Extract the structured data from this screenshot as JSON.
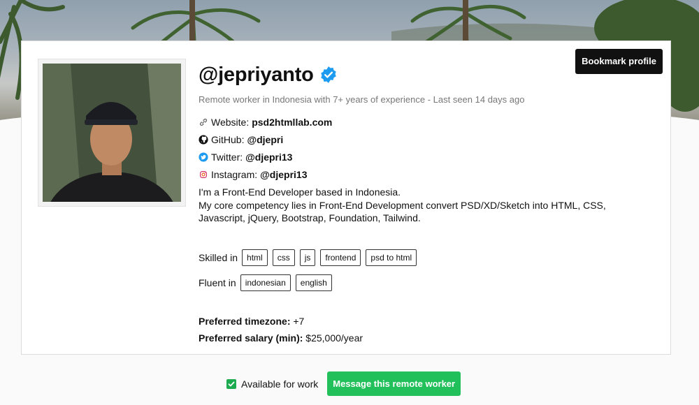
{
  "profile": {
    "username": "@jepriyanto",
    "tagline": "Remote worker in Indonesia with 7+ years of experience - Last seen 14 days ago",
    "bookmark_label": "Bookmark profile",
    "links": [
      {
        "label": "Website:",
        "value": "psd2htmllab.com",
        "icon": "link-icon"
      },
      {
        "label": "GitHub:",
        "value": "@djepri",
        "icon": "github-icon"
      },
      {
        "label": "Twitter:",
        "value": "@djepri13",
        "icon": "twitter-icon"
      },
      {
        "label": "Instagram:",
        "value": "@djepri13",
        "icon": "instagram-icon"
      }
    ],
    "bio": [
      "I'm a Front-End Developer based in Indonesia.",
      "My core competency lies in Front-End Development convert PSD/XD/Sketch into HTML, CSS, Javascript, jQuery, Bootstrap, Foundation, Tailwind."
    ],
    "skills_label": "Skilled in",
    "skills": [
      "html",
      "css",
      "js",
      "frontend",
      "psd to html"
    ],
    "languages_label": "Fluent in",
    "languages": [
      "indonesian",
      "english"
    ],
    "timezone_label": "Preferred timezone:",
    "timezone_value": "+7",
    "salary_label": "Preferred salary (min):",
    "salary_value": "$25,000/year"
  },
  "footer": {
    "available_label": "Available for work",
    "available_checked": true,
    "message_label": "Message this remote worker"
  },
  "colors": {
    "verified": "#1d9bf0",
    "primary_green": "#22c05a",
    "dark_button": "#111111"
  }
}
